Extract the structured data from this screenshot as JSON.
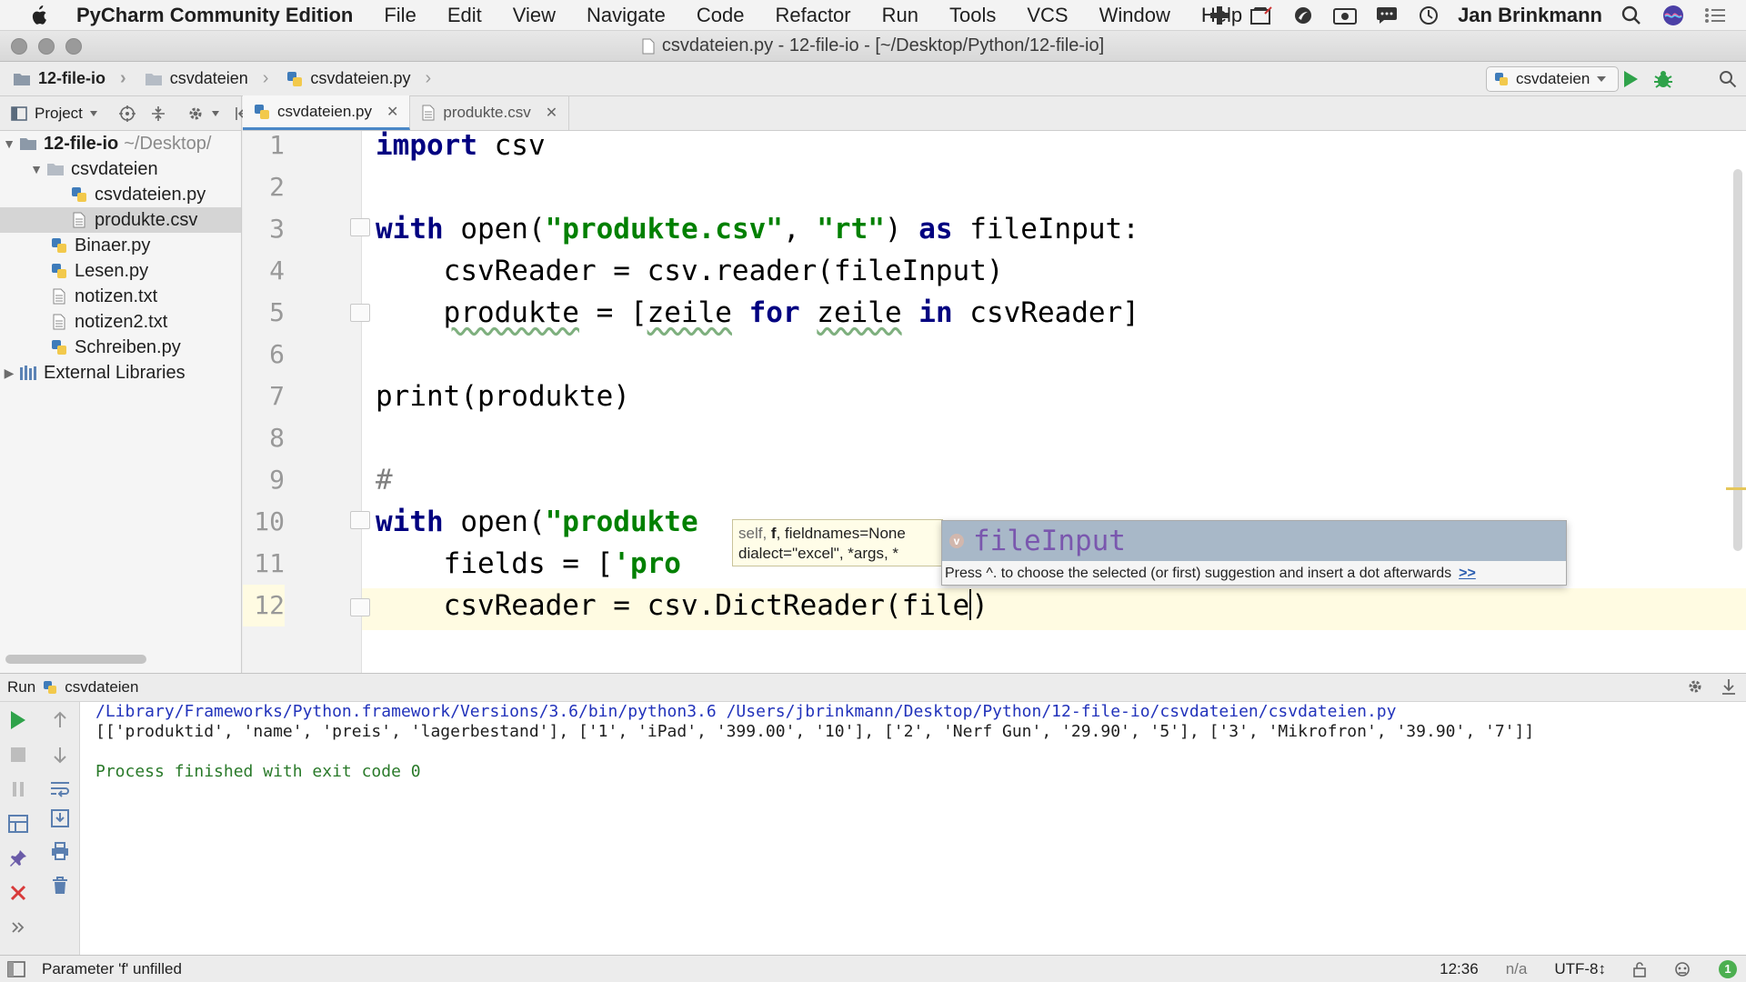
{
  "menubar": {
    "app_name": "PyCharm Community Edition",
    "items": [
      "File",
      "Edit",
      "View",
      "Navigate",
      "Code",
      "Refactor",
      "Run",
      "Tools",
      "VCS",
      "Window",
      "Help"
    ],
    "user": "Jan Brinkmann"
  },
  "window": {
    "title": "csvdateien.py - 12-file-io - [~/Desktop/Python/12-file-io]"
  },
  "breadcrumbs": [
    "12-file-io",
    "csvdateien",
    "csvdateien.py"
  ],
  "run_config": {
    "label": "csvdateien"
  },
  "project": {
    "header_label": "Project",
    "tree": [
      {
        "label": "12-file-io",
        "extra": "~/Desktop/",
        "type": "folder",
        "level": 0,
        "expanded": true
      },
      {
        "label": "csvdateien",
        "type": "folder",
        "level": 1,
        "expanded": true
      },
      {
        "label": "csvdateien.py",
        "type": "python",
        "level": 2
      },
      {
        "label": "produkte.csv",
        "type": "text",
        "level": 2,
        "selected": true
      },
      {
        "label": "Binaer.py",
        "type": "python",
        "level": 1
      },
      {
        "label": "Lesen.py",
        "type": "python",
        "level": 1
      },
      {
        "label": "notizen.txt",
        "type": "text",
        "level": 1
      },
      {
        "label": "notizen2.txt",
        "type": "text",
        "level": 1
      },
      {
        "label": "Schreiben.py",
        "type": "python",
        "level": 1
      },
      {
        "label": "External Libraries",
        "type": "library",
        "level": 0,
        "expanded": false
      }
    ]
  },
  "editor_tabs": [
    {
      "label": "csvdateien.py",
      "active": true
    },
    {
      "label": "produkte.csv",
      "active": false
    }
  ],
  "editor": {
    "line_numbers": [
      "1",
      "2",
      "3",
      "4",
      "5",
      "6",
      "7",
      "8",
      "9",
      "10",
      "11",
      "12"
    ],
    "lines": [
      "import csv",
      "",
      "with open(\"produkte.csv\", \"rt\") as fileInput:",
      "    csvReader = csv.reader(fileInput)",
      "    produkte = [zeile for zeile in csvReader]",
      "",
      "print(produkte)",
      "",
      "#",
      "with open(\"produkte",
      "    fields = ['pro",
      "    csvReader = csv.DictReader(file)"
    ],
    "current_line": "12"
  },
  "param_info": {
    "line1_a": "self, ",
    "line1_b": "f",
    "line1_c": ", fieldnames=None",
    "line2": "dialect=\"excel\", *args, *"
  },
  "completion": {
    "badge": "v",
    "suggestion": "fileInput",
    "hint": "Press ^. to choose the selected (or first) suggestion and insert a dot afterwards",
    "more": ">>"
  },
  "run_panel": {
    "label": "Run",
    "config": "csvdateien",
    "output": [
      "/Library/Frameworks/Python.framework/Versions/3.6/bin/python3.6 /Users/jbrinkmann/Desktop/Python/12-file-io/csvdateien/csvdateien.py",
      "[['produktid', 'name', 'preis', 'lagerbestand'], ['1', 'iPad', '399.00', '10'], ['2', 'Nerf Gun', '29.90', '5'], ['3', 'Mikrofron', '39.90', '7']]",
      "",
      "Process finished with exit code 0"
    ]
  },
  "statusbar": {
    "message": "Parameter 'f' unfilled",
    "position": "12:36",
    "line_sep": "n/a",
    "encoding": "UTF-8↕",
    "badge": "1"
  },
  "colors": {
    "keyword": "#000080",
    "string": "#008000",
    "current_line": "#fffbe2",
    "completion_selected": "#a8b8c8",
    "run_green": "#2fa24a",
    "stop_red": "#d83a3a"
  }
}
